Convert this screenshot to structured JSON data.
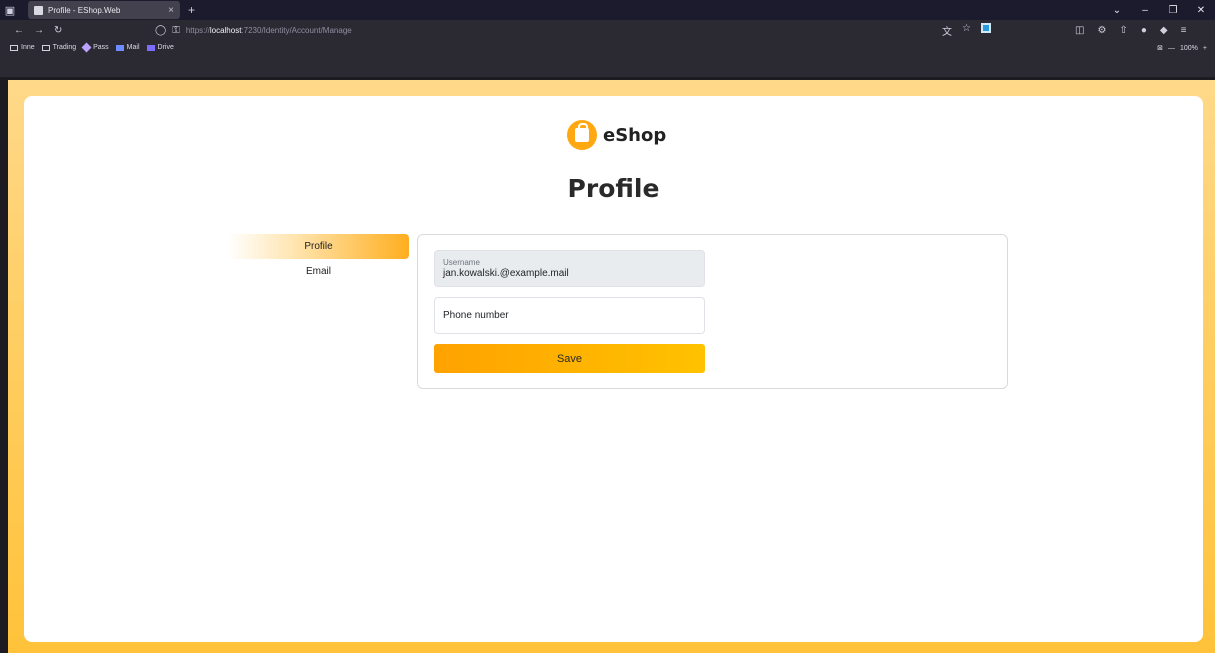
{
  "browser": {
    "tab_title": "Profile - EShop.Web",
    "tab_close": "×",
    "new_tab": "+",
    "url_scheme": "https://",
    "url_host": "localhost",
    "url_path": ":7230/Identity/Account/Manage",
    "bookmarks": [
      "Inne",
      "Trading",
      "Pass",
      "Mail",
      "Drive"
    ],
    "zoom_level": "100%",
    "zoom_minus": "—",
    "zoom_plus": "+"
  },
  "brand": {
    "name": "eShop",
    "accent_color": "#ffa812"
  },
  "page": {
    "title": "Profile"
  },
  "side_nav": {
    "items": [
      {
        "label": "Profile",
        "active": true
      },
      {
        "label": "Email",
        "active": false
      }
    ]
  },
  "form": {
    "username_label": "Username",
    "username_value": "jan.kowalski.@example.mail",
    "phone_placeholder": "Phone number",
    "save_label": "Save"
  }
}
